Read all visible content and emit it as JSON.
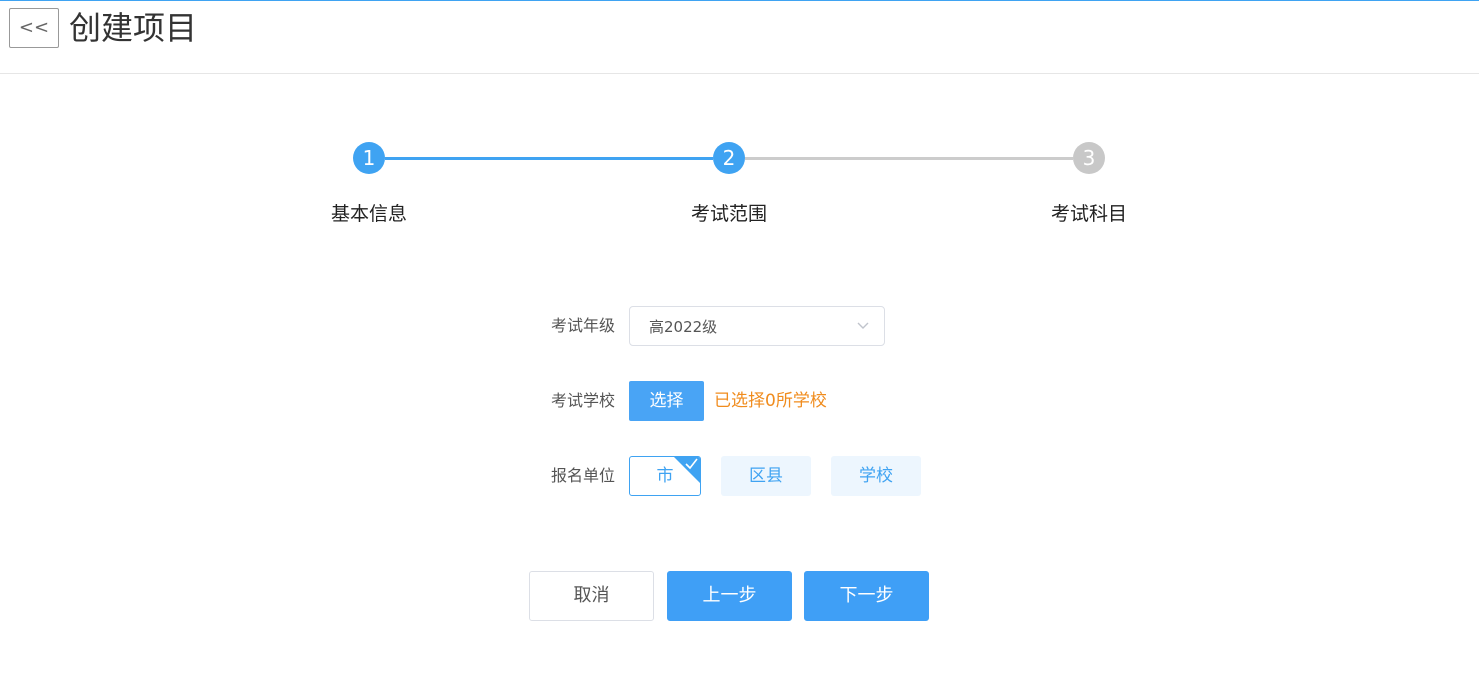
{
  "header": {
    "back_label": "<<",
    "title": "创建项目"
  },
  "steps": [
    {
      "number": "1",
      "label": "基本信息",
      "state": "completed"
    },
    {
      "number": "2",
      "label": "考试范围",
      "state": "active"
    },
    {
      "number": "3",
      "label": "考试科目",
      "state": "pending"
    }
  ],
  "form": {
    "grade": {
      "label": "考试年级",
      "value": "高2022级",
      "icon": "chevron-down-icon"
    },
    "school": {
      "label": "考试学校",
      "button_label": "选择",
      "selected_text": "已选择0所学校"
    },
    "unit": {
      "label": "报名单位",
      "options": [
        {
          "label": "市",
          "selected": true
        },
        {
          "label": "区县",
          "selected": false
        },
        {
          "label": "学校",
          "selected": false
        }
      ]
    }
  },
  "actions": {
    "cancel_label": "取消",
    "prev_label": "上一步",
    "next_label": "下一步"
  },
  "colors": {
    "accent": "#3fa3f2",
    "warning_text": "#f08c1e",
    "inactive_step": "#c8c8c8"
  }
}
